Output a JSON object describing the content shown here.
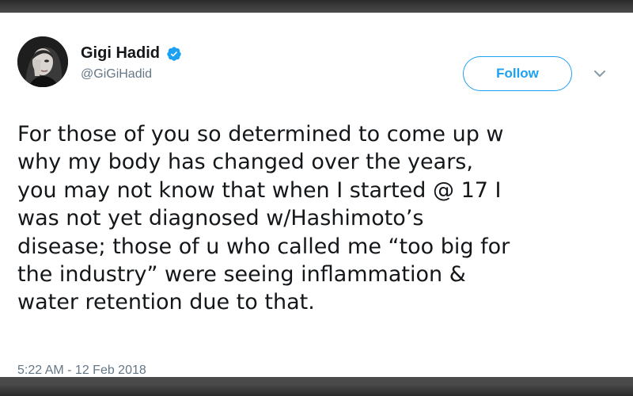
{
  "tweet": {
    "author": {
      "display_name": "Gigi Hadid",
      "handle": "@GiGiHadid",
      "verified": true
    },
    "follow_label": "Follow",
    "text": "For those of you so determined to come up w\nwhy my body has changed over the years,\nyou may not know that when I started @ 17 I\nwas not yet diagnosed w/Hashimoto’s\ndisease; those of u who called me “too big for\nthe industry” were seeing inflammation &\nwater retention due to that.",
    "timestamp": "5:22 AM - 12 Feb 2018"
  },
  "colors": {
    "accent": "#1da1f2",
    "text": "#14171a",
    "secondary": "#657786"
  },
  "icons": {
    "verified": "verified-badge-icon",
    "menu": "chevron-down-icon"
  }
}
